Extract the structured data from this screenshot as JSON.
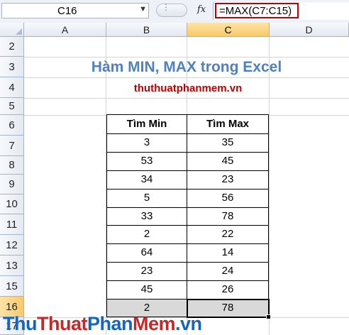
{
  "formula_bar": {
    "name_box": "C16",
    "fx_label": "fx",
    "formula": "=MAX(C7:C15)"
  },
  "columns": [
    "A",
    "B",
    "C",
    "D"
  ],
  "selected_column": "C",
  "rows": [
    "2",
    "3",
    "4",
    "5",
    "6",
    "7",
    "8",
    "9",
    "10",
    "11",
    "12",
    "13",
    "14",
    "15",
    "16",
    "17"
  ],
  "selected_row": "16",
  "sheet": {
    "title": "Hàm MIN, MAX trong Excel",
    "subtitle": "thuthuatphanmem.vn",
    "table": {
      "headers": [
        "Tìm Min",
        "Tìm Max"
      ],
      "rows": [
        [
          "3",
          "35"
        ],
        [
          "53",
          "45"
        ],
        [
          "34",
          "23"
        ],
        [
          "5",
          "56"
        ],
        [
          "33",
          "78"
        ],
        [
          "2",
          "22"
        ],
        [
          "64",
          "14"
        ],
        [
          "23",
          "24"
        ],
        [
          "45",
          "26"
        ]
      ],
      "totals": [
        "2",
        "78"
      ]
    }
  },
  "watermark": {
    "parts": [
      "Thu",
      "Thuat",
      "Phan",
      "Mem",
      ".vn"
    ],
    "colors": [
      "#1565c0",
      "#c62828",
      "#1565c0",
      "#c62828",
      "#1565c0"
    ]
  }
}
